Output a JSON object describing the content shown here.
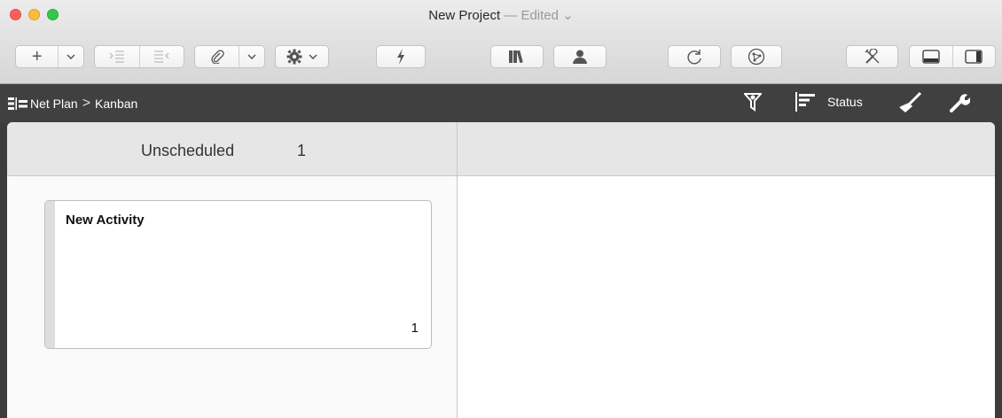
{
  "window": {
    "title": "New Project",
    "edited": "Edited",
    "dash": "—",
    "chevron": "⌄"
  },
  "toolbar": {
    "add_icon": "+",
    "chevron": "⌄"
  },
  "breadcrumb": {
    "root": "Net Plan",
    "separator": ">",
    "current": "Kanban"
  },
  "view_controls": {
    "group_label": "Status"
  },
  "board": {
    "columns": [
      {
        "title": "Unscheduled",
        "count": "1"
      },
      {
        "title": "",
        "count": ""
      }
    ],
    "cards": [
      {
        "name": "New Activity",
        "number": "1"
      }
    ]
  },
  "colors": {
    "accent_dark": "#404040",
    "card_stripe": "#dedede"
  },
  "icons": [
    "add-icon",
    "chevron-down-icon",
    "indent-icon",
    "outdent-icon",
    "paperclip-icon",
    "gear-icon",
    "lightning-icon",
    "library-icon",
    "person-icon",
    "refresh-icon",
    "network-icon",
    "tools-icon",
    "bottom-panel-icon",
    "side-panel-icon",
    "net-plan-icon",
    "filter-icon",
    "group-by-icon",
    "brush-icon",
    "wrench-icon"
  ]
}
